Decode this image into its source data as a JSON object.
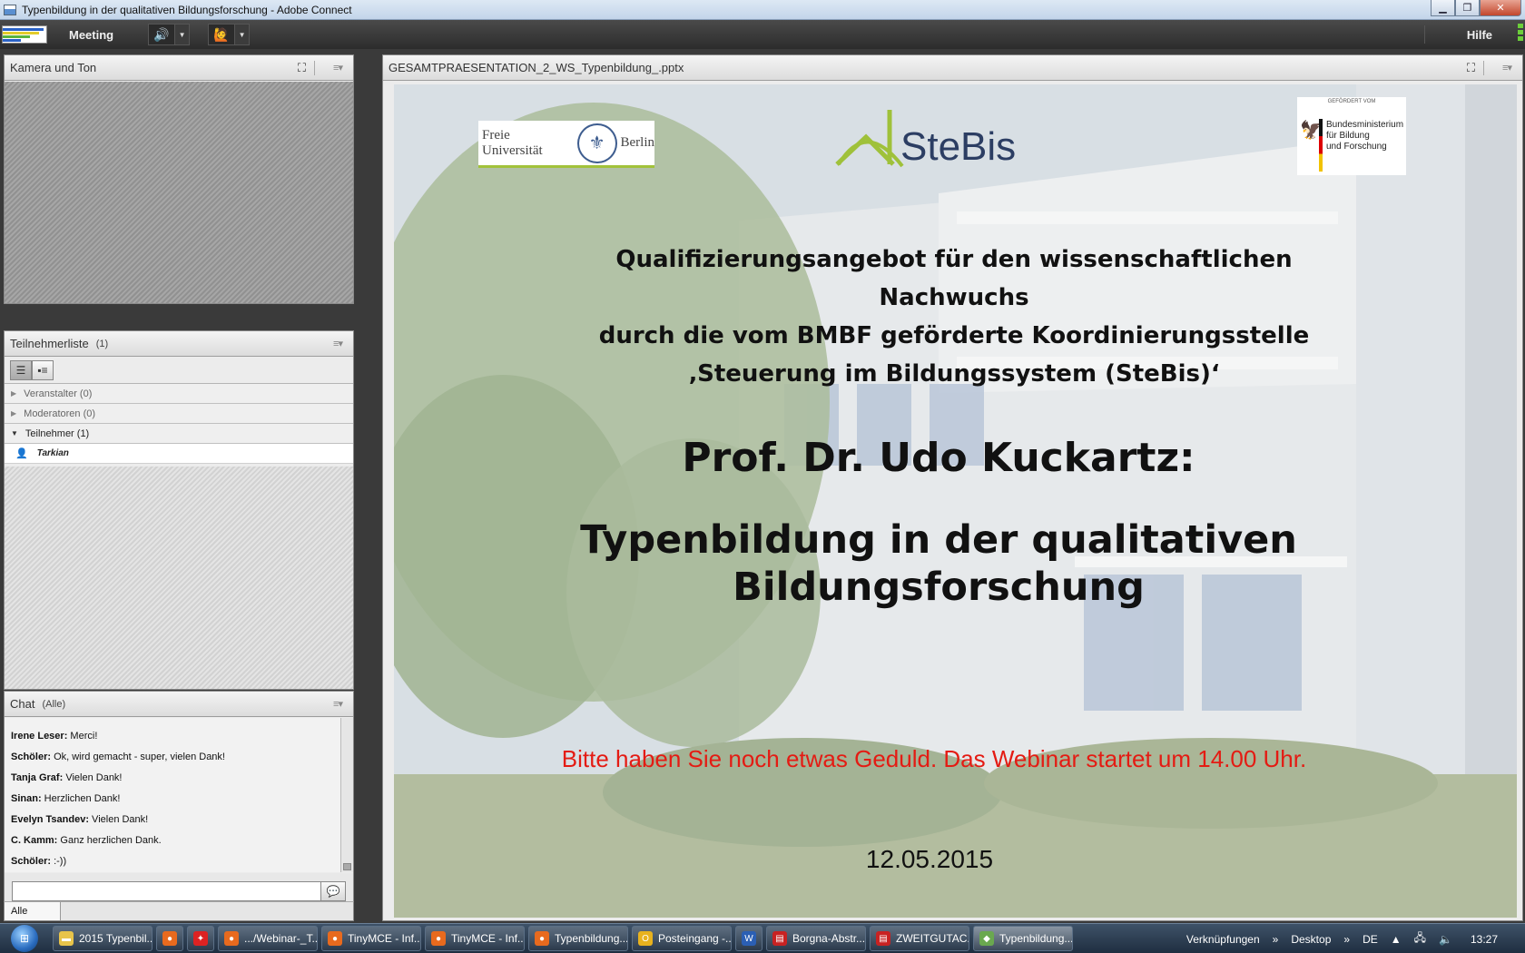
{
  "window": {
    "title": "Typenbildung in der qualitativen Bildungsforschung - Adobe Connect",
    "minimize": "▁",
    "restore": "❐",
    "close": "✕"
  },
  "menubar": {
    "meeting": "Meeting",
    "help": "Hilfe",
    "speaker_icon": "speaker-icon",
    "presenter_icon": "person-icon"
  },
  "camera_pod": {
    "title": "Kamera und Ton"
  },
  "attendee_pod": {
    "title": "Teilnehmerliste",
    "count": "(1)",
    "groups": [
      {
        "label": "Veranstalter (0)",
        "open": false
      },
      {
        "label": "Moderatoren (0)",
        "open": false
      },
      {
        "label": "Teilnehmer (1)",
        "open": true
      }
    ],
    "people": [
      "Tarkian"
    ]
  },
  "chat_pod": {
    "title": "Chat",
    "scope": "(Alle)",
    "messages": [
      {
        "name": "Irene Leser:",
        "text": " Merci!"
      },
      {
        "name": "Schöler:",
        "text": " Ok, wird gemacht - super, vielen Dank!"
      },
      {
        "name": "Tanja Graf:",
        "text": " Vielen Dank!"
      },
      {
        "name": "Sinan:",
        "text": " Herzlichen Dank!"
      },
      {
        "name": "Evelyn Tsandev:",
        "text": " Vielen Dank!"
      },
      {
        "name": "C. Kamm:",
        "text": " Ganz herzlichen Dank."
      },
      {
        "name": "Schöler:",
        "text": " :-))"
      }
    ],
    "input_value": "",
    "tab": "Alle"
  },
  "share_pod": {
    "title": "GESAMTPRAESENTATION_2_WS_Typenbildung_.pptx"
  },
  "slide": {
    "fu_logo_left": "Freie Universität",
    "fu_logo_right": "Berlin",
    "stebis": "SteBis",
    "bmbf_top": "GEFÖRDERT VOM",
    "bmbf_line1": "Bundesministerium",
    "bmbf_line2": "für Bildung",
    "bmbf_line3": "und Forschung",
    "q_line1": "Qualifizierungsangebot für den wissenschaftlichen Nachwuchs",
    "q_line2": "durch die vom BMBF geförderte Koordinierungsstelle",
    "q_line3": "‚Steuerung im Bildungssystem (SteBis)‘",
    "speaker": "Prof. Dr. Udo Kuckartz:",
    "topic_line1": "Typenbildung in der qualitativen",
    "topic_line2": "Bildungsforschung",
    "notice": "Bitte haben Sie noch etwas Geduld. Das Webinar startet um 14.00 Uhr.",
    "date": "12.05.2015",
    "notice_color": "#e41b13"
  },
  "taskbar": {
    "items": [
      {
        "label": "2015 Typenbil...",
        "icon": "folder-icon",
        "color": "#e8c44a"
      },
      {
        "label": "",
        "icon": "firefox-icon",
        "color": "#e86a1e"
      },
      {
        "label": "",
        "icon": "maple-leaf-icon",
        "color": "#d22"
      },
      {
        "label": ".../Webinar-_T...",
        "icon": "firefox-icon",
        "color": "#e86a1e"
      },
      {
        "label": "TinyMCE - Inf...",
        "icon": "firefox-icon",
        "color": "#e86a1e"
      },
      {
        "label": "TinyMCE - Inf...",
        "icon": "firefox-icon",
        "color": "#e86a1e"
      },
      {
        "label": "Typenbildung...",
        "icon": "firefox-icon",
        "color": "#e86a1e"
      },
      {
        "label": "Posteingang -...",
        "icon": "outlook-icon",
        "color": "#e8b21e"
      },
      {
        "label": "",
        "icon": "word-icon",
        "color": "#2b5fb4"
      },
      {
        "label": "Borgna-Abstr...",
        "icon": "pdf-icon",
        "color": "#c82222"
      },
      {
        "label": "ZWEITGUTAC...",
        "icon": "pdf-icon",
        "color": "#c82222"
      },
      {
        "label": "Typenbildung...",
        "icon": "adobe-connect-icon",
        "color": "#6aa84f"
      }
    ],
    "links": "Verknüpfungen",
    "desktop": "Desktop",
    "lang": "DE",
    "clock": "13:27",
    "chevron": "»"
  }
}
